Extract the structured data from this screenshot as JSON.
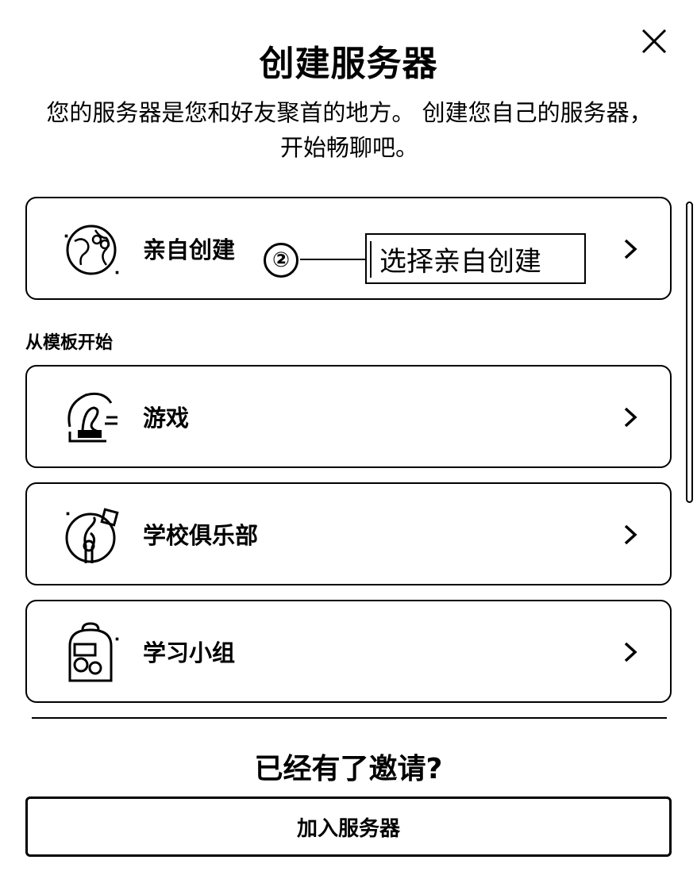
{
  "modal": {
    "title": "创建服务器",
    "subtitle": "您的服务器是您和好友聚首的地方。 创建您自己的服务器，开始畅聊吧。",
    "close_icon": "close-icon"
  },
  "create_own": {
    "label": "亲自创建",
    "icon": "globe-icon"
  },
  "templates": {
    "section_label": "从模板开始",
    "items": [
      {
        "label": "游戏",
        "icon": "game-controller-icon"
      },
      {
        "label": "学校俱乐部",
        "icon": "music-note-icon"
      },
      {
        "label": "学习小组",
        "icon": "backpack-icon"
      }
    ]
  },
  "annotation": {
    "number": "②",
    "text": "选择亲自创建"
  },
  "invite": {
    "title": "已经有了邀请?",
    "join_label": "加入服务器"
  }
}
